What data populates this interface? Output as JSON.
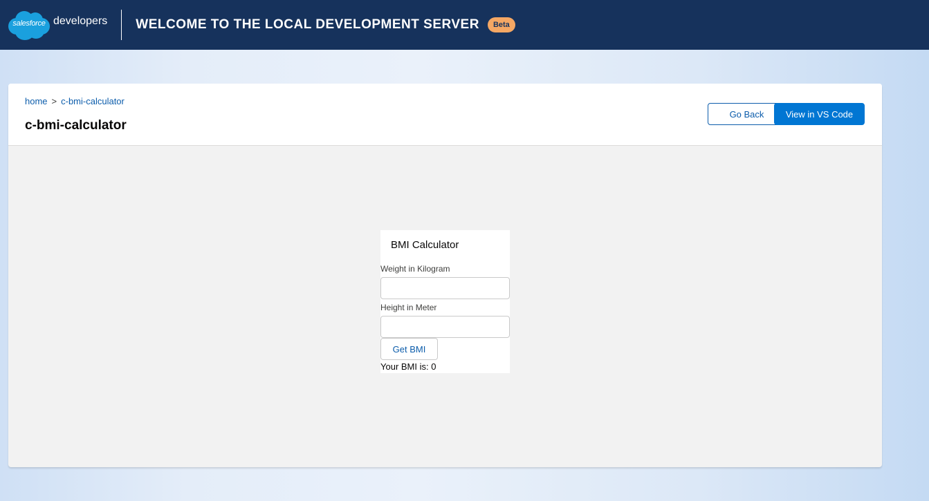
{
  "header": {
    "brand_text": "salesforce",
    "brand_suffix": "developers",
    "title": "Welcome to the Local Development Server",
    "badge": "Beta"
  },
  "breadcrumb": {
    "home": "home",
    "separator": ">",
    "current": "c-bmi-calculator"
  },
  "page": {
    "title": "c-bmi-calculator",
    "go_back_label": "Go Back",
    "vscode_label": "View in VS Code"
  },
  "bmi": {
    "title": "BMI Calculator",
    "weight_label": "Weight in Kilogram",
    "weight_value": "",
    "height_label": "Height in Meter",
    "height_value": "",
    "button_label": "Get BMI",
    "result_text": "Your BMI is: 0"
  },
  "colors": {
    "topbar": "#16325c",
    "brand_blue": "#0176d3",
    "link_blue": "#0b5cab",
    "beta_badge": "#f4a764",
    "cloud": "#1aa0de"
  },
  "icons": {
    "logo": "salesforce-cloud-logo"
  }
}
